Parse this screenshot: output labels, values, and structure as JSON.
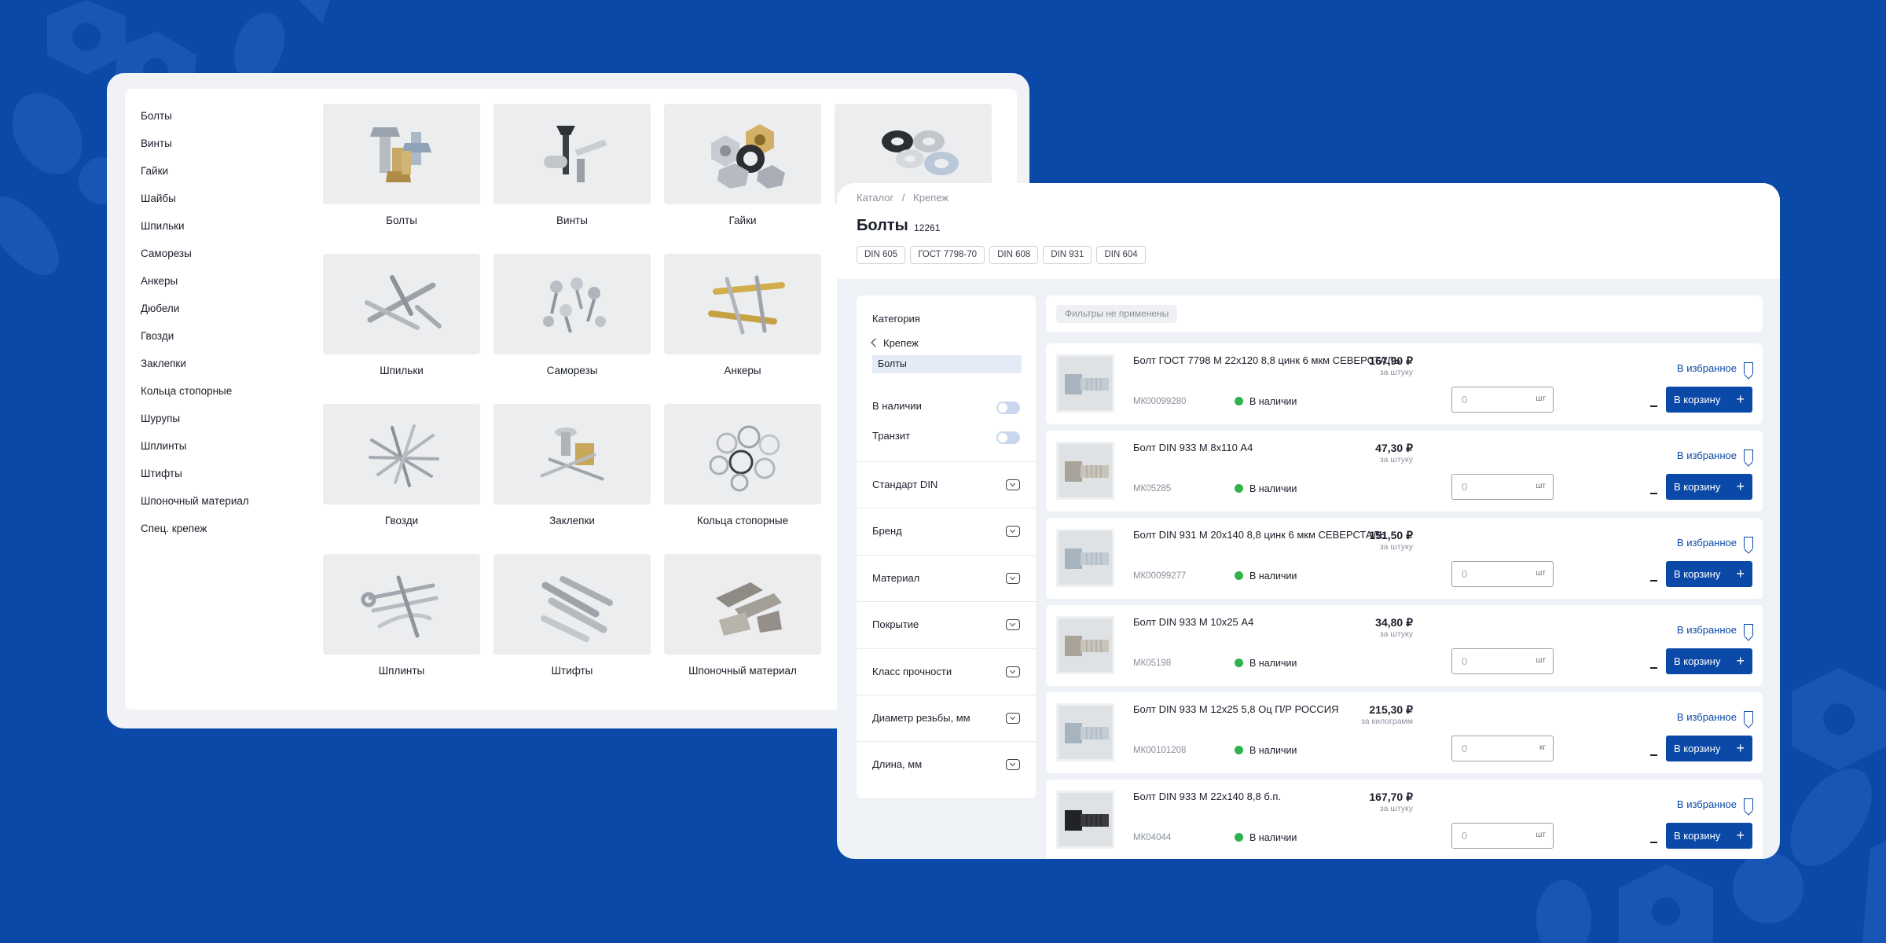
{
  "catalog": {
    "sidebar_items": [
      "Болты",
      "Винты",
      "Гайки",
      "Шайбы",
      "Шпильки",
      "Саморезы",
      "Анкеры",
      "Дюбели",
      "Гвозди",
      "Заклепки",
      "Кольца стопорные",
      "Шурупы",
      "Шплинты",
      "Штифты",
      "Шпоночный материал",
      "Спец. крепеж"
    ],
    "tiles": [
      {
        "name": "Болты",
        "icon": "bolts-image"
      },
      {
        "name": "Винты",
        "icon": "screws-image"
      },
      {
        "name": "Гайки",
        "icon": "nuts-image"
      },
      {
        "name": "",
        "icon": "washers-image"
      },
      {
        "name": "Шпильки",
        "icon": "studs-image"
      },
      {
        "name": "Саморезы",
        "icon": "self-tapping-screws-image"
      },
      {
        "name": "Анкеры",
        "icon": "anchors-image"
      },
      {
        "name": "Гвозди",
        "icon": "nails-image"
      },
      {
        "name": "Заклепки",
        "icon": "rivets-image"
      },
      {
        "name": "Кольца стопорные",
        "icon": "retaining-rings-image"
      },
      {
        "name": "Шплинты",
        "icon": "cotter-pins-image"
      },
      {
        "name": "Штифты",
        "icon": "dowel-pins-image"
      },
      {
        "name": "Шпоночный материал",
        "icon": "key-stock-image"
      }
    ]
  },
  "listing": {
    "breadcrumbs": [
      "Каталог",
      "Крепеж"
    ],
    "breadcrumb_separator": "/",
    "title": "Болты",
    "count": "12261",
    "standard_chips": [
      "DIN 605",
      "ГОСТ 7798-70",
      "DIN 608",
      "DIN 931",
      "DIN 604"
    ],
    "filters": {
      "category_label": "Категория",
      "back_label": "Крепеж",
      "current_category": "Болты",
      "toggles": [
        {
          "label": "В наличии",
          "on": false
        },
        {
          "label": "Транзит",
          "on": false
        }
      ],
      "sections": [
        "Стандарт DIN",
        "Бренд",
        "Материал",
        "Покрытие",
        "Класс прочности",
        "Диаметр резьбы, мм",
        "Длина, мм"
      ]
    },
    "applied_filters_text": "Фильтры не применены",
    "favorite_label": "В избранное",
    "cart_label": "В корзину",
    "products": [
      {
        "name": "Болт ГОСТ 7798 М 22х120 8,8 цинк 6 мкм СЕВЕРСТАЛЬ",
        "sku": "МК00099280",
        "stock": "В наличии",
        "price": "167,90 ₽",
        "unit": "за штуку",
        "qty": "0",
        "qty_unit": "шт",
        "finish": "zinc"
      },
      {
        "name": "Болт DIN 933 М 8х110 А4",
        "sku": "МК05285",
        "stock": "В наличии",
        "price": "47,30 ₽",
        "unit": "за штуку",
        "qty": "0",
        "qty_unit": "шт",
        "finish": "steel"
      },
      {
        "name": "Болт DIN 931 М 20х140 8,8 цинк 6 мкм СЕВЕРСТАЛЬ",
        "sku": "МК00099277",
        "stock": "В наличии",
        "price": "151,50 ₽",
        "unit": "за штуку",
        "qty": "0",
        "qty_unit": "шт",
        "finish": "zinc"
      },
      {
        "name": "Болт DIN 933 М 10х25 А4",
        "sku": "МК05198",
        "stock": "В наличии",
        "price": "34,80 ₽",
        "unit": "за штуку",
        "qty": "0",
        "qty_unit": "шт",
        "finish": "steel"
      },
      {
        "name": "Болт DIN 933 М 12х25 5,8 Оц П/Р РОССИЯ",
        "sku": "МК00101208",
        "stock": "В наличии",
        "price": "215,30 ₽",
        "unit": "за килограмм",
        "qty": "0",
        "qty_unit": "кг",
        "finish": "zinc"
      },
      {
        "name": "Болт DIN 933 М 22х140 8,8 б.п.",
        "sku": "МК04044",
        "stock": "В наличии",
        "price": "167,70 ₽",
        "unit": "за штуку",
        "qty": "0",
        "qty_unit": "шт",
        "finish": "black"
      }
    ]
  },
  "colors": {
    "background": "#0a49a8",
    "accent": "#0a49a8",
    "in_stock": "#2fb14c"
  }
}
